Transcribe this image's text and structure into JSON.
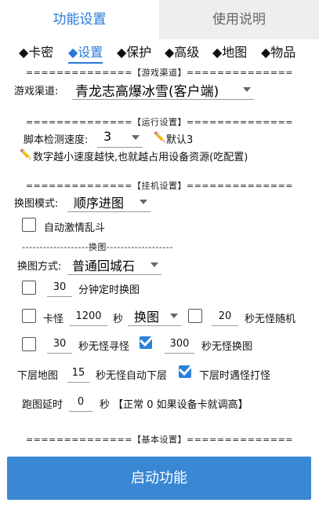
{
  "tabs": {
    "active": "功能设置",
    "inactive": "使用说明"
  },
  "subtabs": [
    "◆卡密",
    "◆设置",
    "◆保护",
    "◆高级",
    "◆地图",
    "◆物品"
  ],
  "sections": {
    "channel": "==============【游戏渠道】==============",
    "run": "==============【运行设置】==============",
    "hangup": "==============【挂机设置】==============",
    "switch_map": "-------------------换图-------------------",
    "basic": "==============【基本设置】=============="
  },
  "channel": {
    "label": "游戏渠道:",
    "value": "青龙志高爆冰雪(客户端)"
  },
  "speed": {
    "label": "脚本检测速度:",
    "value": "3",
    "default_note": "默认3",
    "hint": "数字越小速度越快,也就越占用设备资源(吃配置)"
  },
  "map_mode": {
    "label": "换图模式:",
    "value": "顺序进图"
  },
  "auto_passion": {
    "label": "自动激情乱斗",
    "checked": false
  },
  "switch_method": {
    "label": "换图方式:",
    "value": "普通回城石"
  },
  "timer_switch": {
    "value": "30",
    "label": "分钟定时换图",
    "checked": false
  },
  "stuck": {
    "label": "卡怪",
    "value": "1200",
    "unit": "秒",
    "action": "换图"
  },
  "no_monster_random": {
    "value": "20",
    "label": "秒无怪随机",
    "checked": false
  },
  "no_monster_find": {
    "value": "30",
    "label": "秒无怪寻怪",
    "checked": false
  },
  "no_monster_switch": {
    "value": "300",
    "label": "秒无怪换图",
    "checked": true
  },
  "lower_map": {
    "label": "下层地图",
    "value": "15",
    "suffix": "秒无怪自动下层"
  },
  "lower_fight": {
    "label": "下层时遇怪打怪",
    "checked": true
  },
  "run_delay": {
    "label": "跑图延时",
    "value": "0",
    "suffix": "秒 【正常 0 如果设备卡就调高】"
  },
  "start_button": "启动功能",
  "colors": {
    "accent": "#2979d8",
    "button": "#3a87d4",
    "checkbox_checked": "#2a82d6"
  },
  "icons": {
    "hint_icon": "pencil-emoji"
  }
}
